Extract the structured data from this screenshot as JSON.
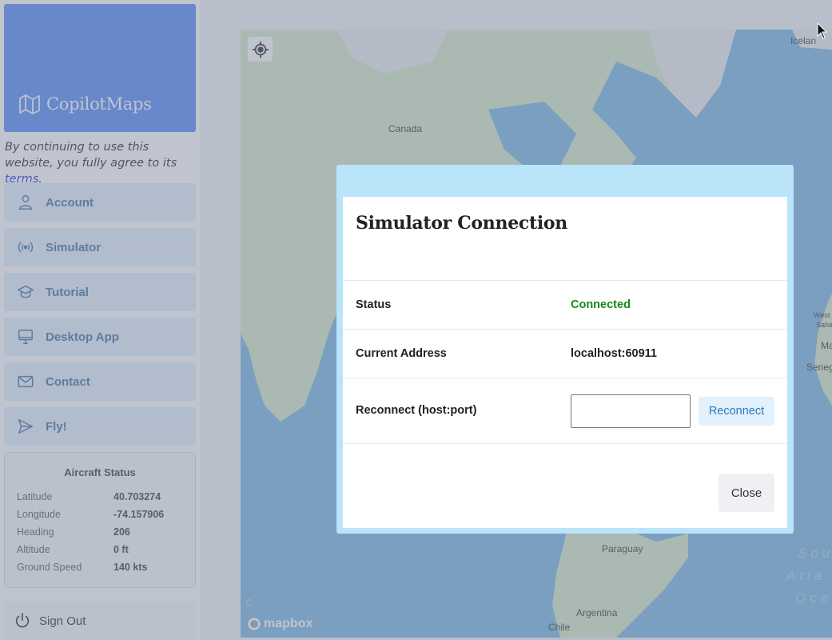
{
  "app": {
    "brand": "CopilotMaps",
    "terms_text": "By continuing to use this website, you fully agree to its ",
    "terms_link": "terms",
    "terms_end": "."
  },
  "sidebar": {
    "items": [
      {
        "label": "Account",
        "icon": "user-icon"
      },
      {
        "label": "Simulator",
        "icon": "broadcast-icon"
      },
      {
        "label": "Tutorial",
        "icon": "graduation-cap-icon"
      },
      {
        "label": "Desktop App",
        "icon": "monitor-icon"
      },
      {
        "label": "Contact",
        "icon": "envelope-icon"
      },
      {
        "label": "Fly!",
        "icon": "paper-plane-icon"
      }
    ],
    "signout_label": "Sign Out"
  },
  "aircraft_status": {
    "title": "Aircraft Status",
    "rows": [
      {
        "label": "Latitude",
        "value": "40.703274"
      },
      {
        "label": "Longitude",
        "value": "-74.157906"
      },
      {
        "label": "Heading",
        "value": "206"
      },
      {
        "label": "Altitude",
        "value": "0 ft"
      },
      {
        "label": "Ground Speed",
        "value": "140 kts"
      }
    ]
  },
  "map": {
    "labels": {
      "canada": "Canada",
      "iceland": "Icelan",
      "paraguay": "Paraguay",
      "argentina": "Argentina",
      "chile": "Chile",
      "western_sahara": "West",
      "western_sahara_2": "Saha",
      "mauritania": "Ma",
      "senegal": "Senega",
      "south_atlantic_1": "Sou",
      "south_atlantic_2": "Atla",
      "south_atlantic_3": "Oce",
      "pacific_fragment": "c"
    },
    "attribution": "mapbox"
  },
  "modal": {
    "title": "Simulator Connection",
    "status_label": "Status",
    "status_value": "Connected",
    "address_label": "Current Address",
    "address_value": "localhost:60911",
    "reconnect_label": "Reconnect (host:port)",
    "reconnect_input_value": "",
    "reconnect_button": "Reconnect",
    "close_button": "Close"
  },
  "colors": {
    "brand": "#4f86f7",
    "nav_bg": "#e2effb",
    "status_ok": "#178a17",
    "modal_header": "#b9e4fa"
  }
}
